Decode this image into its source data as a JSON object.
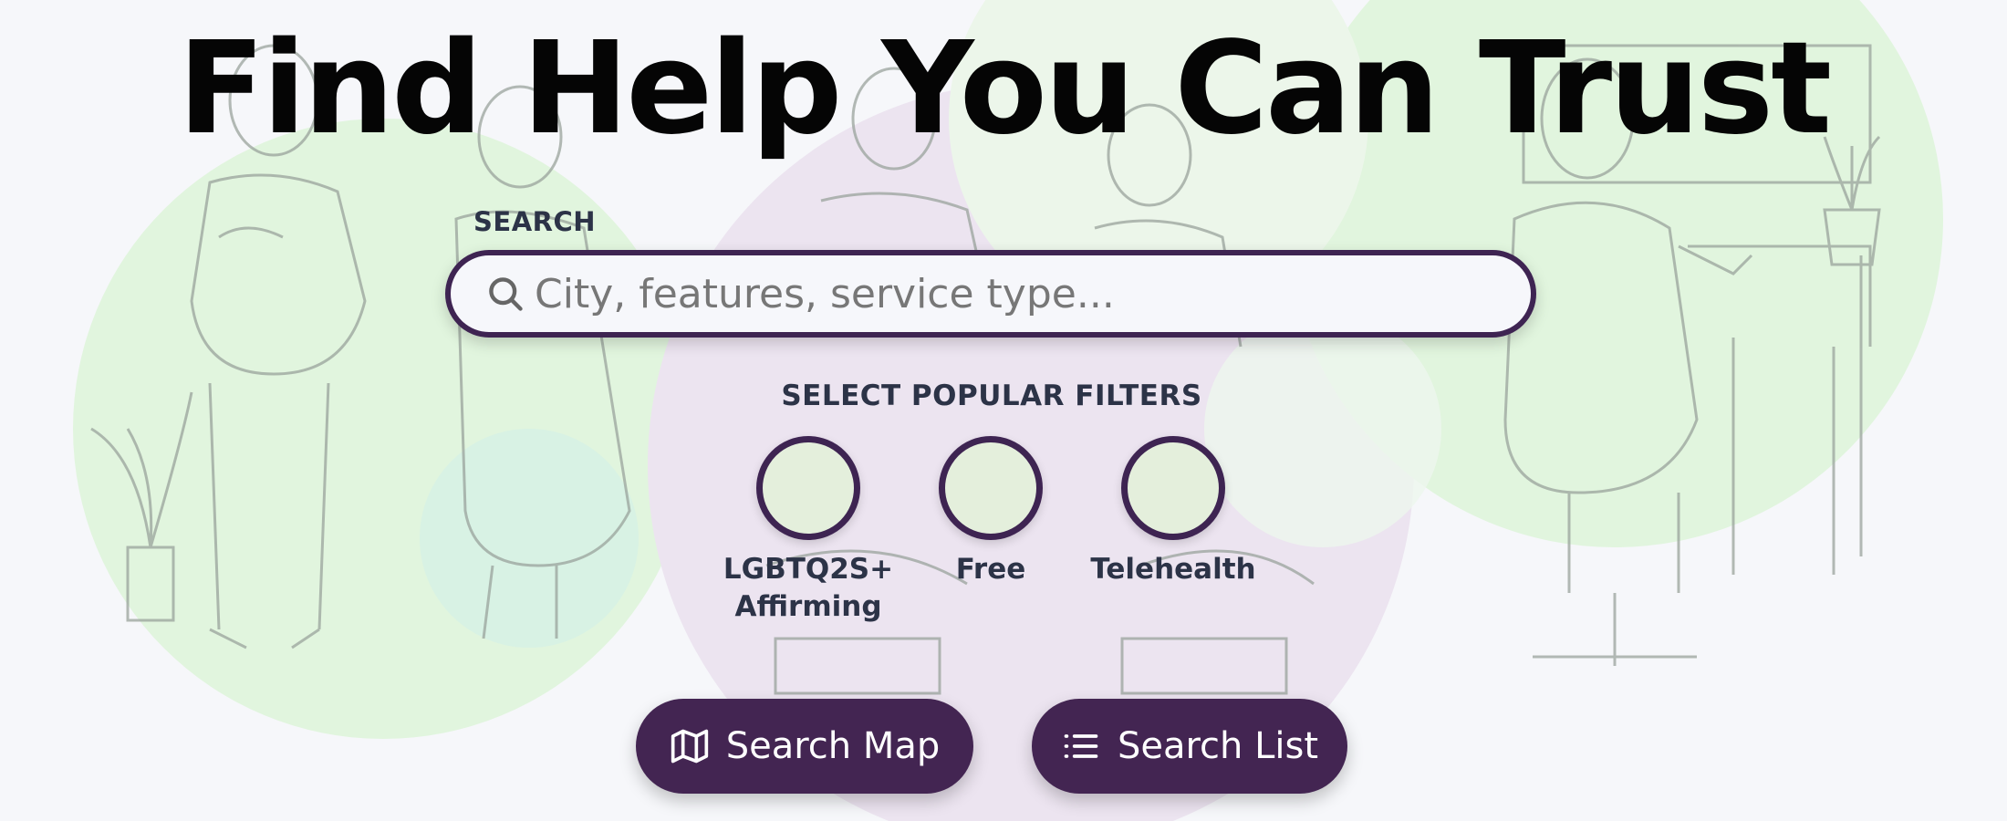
{
  "hero": {
    "title": "Find Help You Can Trust"
  },
  "search": {
    "label": "SEARCH",
    "placeholder": "City, features, service type..."
  },
  "filters": {
    "label": "SELECT POPULAR FILTERS",
    "items": [
      {
        "line1": "LGBTQ2S+",
        "line2": "Affirming",
        "selected": false
      },
      {
        "line1": "Free",
        "line2": "",
        "selected": false
      },
      {
        "line1": "Telehealth",
        "line2": "",
        "selected": false
      }
    ]
  },
  "actions": {
    "map_label": "Search Map",
    "list_label": "Search List"
  },
  "colors": {
    "accent": "#432552",
    "filter_fill": "#e4efdc",
    "blob_green": "#d9f2d6",
    "blob_purple": "#e8dcec"
  },
  "icons": {
    "search": "search-icon",
    "map": "map-icon",
    "list": "list-icon"
  }
}
